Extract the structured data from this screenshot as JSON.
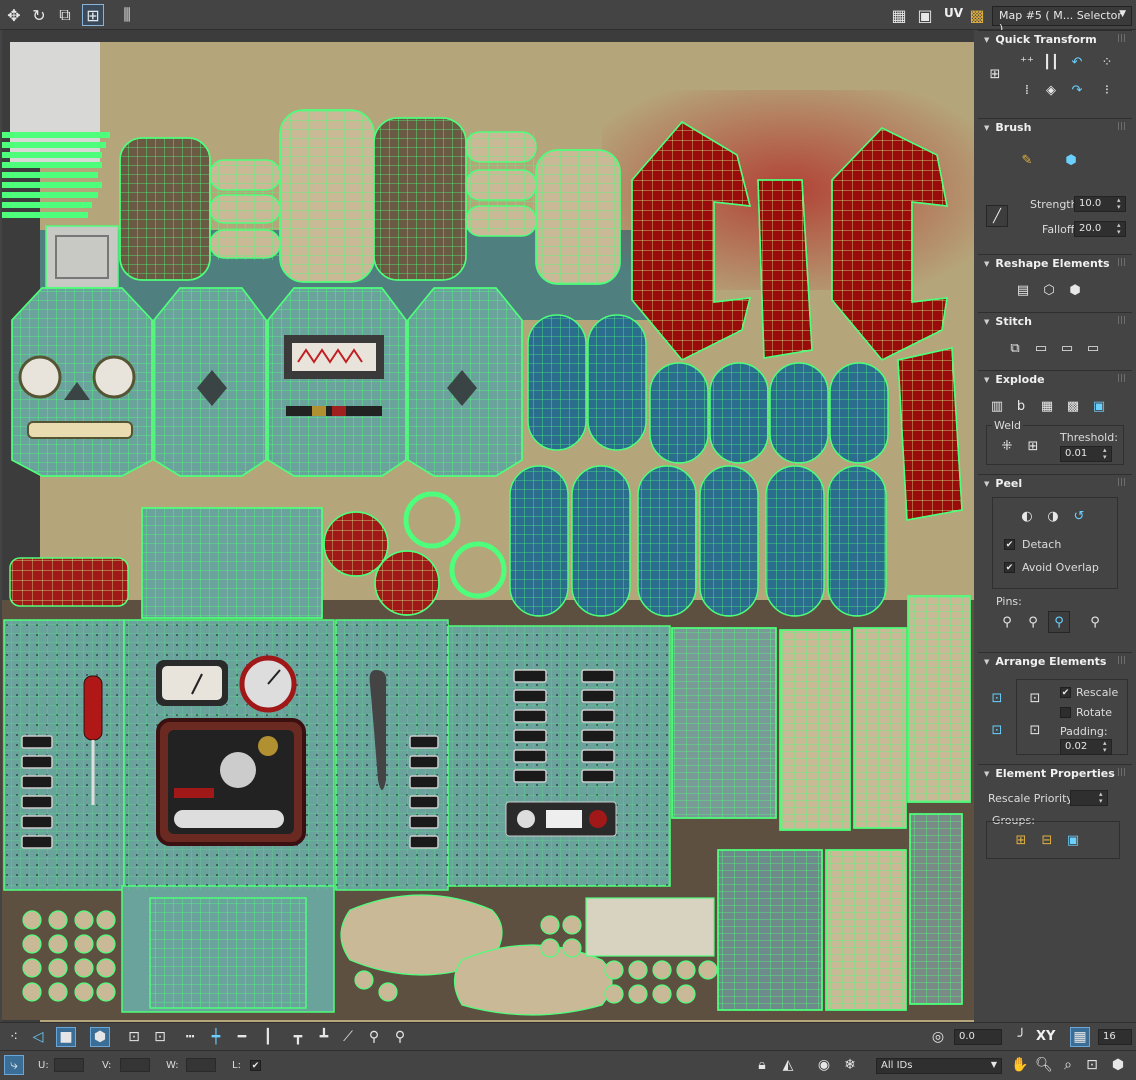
{
  "toolbar": {
    "uv_label": "UV",
    "map_selector": "Map #5 ( M... Selector )"
  },
  "panel": {
    "quick_transform": {
      "title": "Quick Transform"
    },
    "brush": {
      "title": "Brush",
      "strength_label": "Strength:",
      "strength_value": "10.0",
      "falloff_label": "Falloff:",
      "falloff_value": "20.0"
    },
    "reshape": {
      "title": "Reshape Elements"
    },
    "stitch": {
      "title": "Stitch"
    },
    "explode": {
      "title": "Explode",
      "weld_label": "Weld",
      "threshold_label": "Threshold:",
      "threshold_value": "0.01"
    },
    "peel": {
      "title": "Peel",
      "detach_label": "Detach",
      "detach_checked": true,
      "avoid_overlap_label": "Avoid Overlap",
      "avoid_overlap_checked": true,
      "pins_label": "Pins:"
    },
    "arrange": {
      "title": "Arrange Elements",
      "rescale_label": "Rescale",
      "rescale_checked": true,
      "rotate_label": "Rotate",
      "rotate_checked": false,
      "padding_label": "Padding:",
      "padding_value": "0.02"
    },
    "element_props": {
      "title": "Element Properties",
      "rescale_priority_label": "Rescale Priority:",
      "rescale_priority_value": "",
      "groups_label": "Groups:"
    }
  },
  "bottom": {
    "angle_value": "0.0",
    "xy_label": "XY",
    "grid_value": "16",
    "u_label": "U:",
    "v_label": "V:",
    "w_label": "W:",
    "l_label": "L:",
    "ids_value": "All IDs"
  },
  "colors": {
    "wire": "#4dff7a",
    "teal_fill": "#5b9a96",
    "blue_fill": "#2b6d8c",
    "red_fill": "#a01010",
    "tan_bg": "#b5a57a",
    "brown_bg": "#6e5a44"
  }
}
